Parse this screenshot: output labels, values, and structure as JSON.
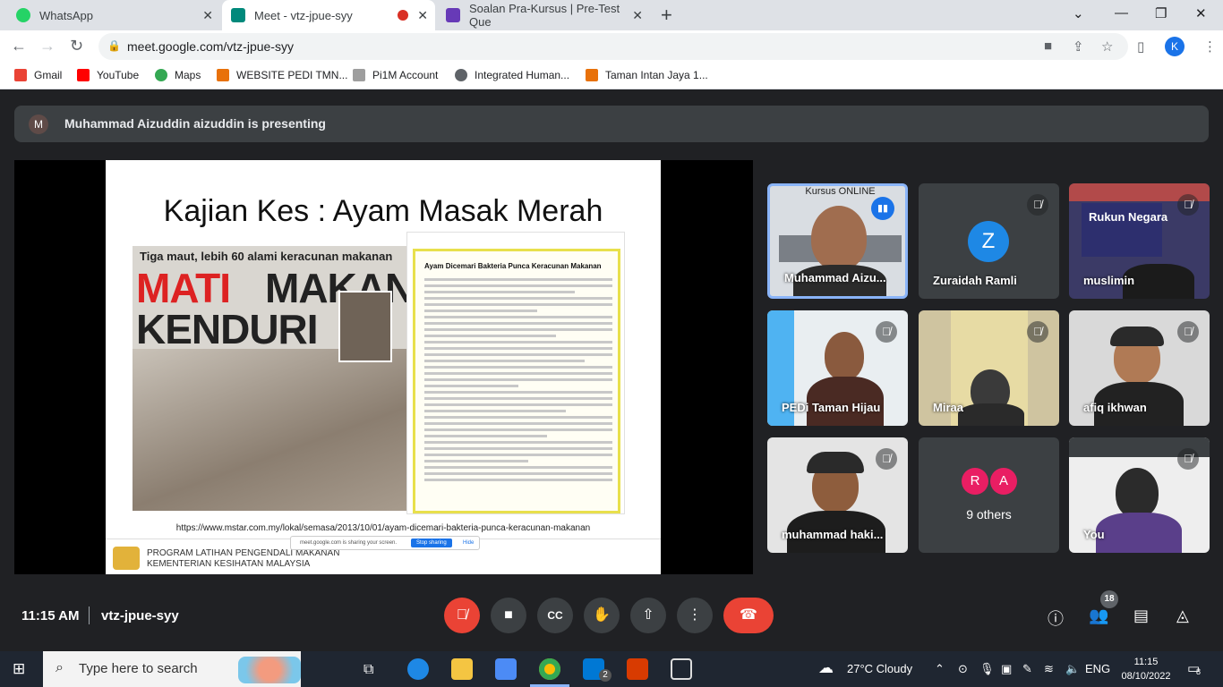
{
  "browser": {
    "tabs": [
      {
        "label": "WhatsApp",
        "favicon_color": "#25d366"
      },
      {
        "label": "Meet - vtz-jpue-syy",
        "favicon_color": "#00897b",
        "recording": true
      },
      {
        "label": "Soalan Pra-Kursus | Pre-Test Que",
        "favicon_color": "#673ab7"
      }
    ],
    "new_tab": "+",
    "url": "meet.google.com/vtz-jpue-syy",
    "profile_initial": "K",
    "bookmarks": [
      {
        "label": "Gmail",
        "color": "#ea4335"
      },
      {
        "label": "YouTube",
        "color": "#ff0000"
      },
      {
        "label": "Maps",
        "color": "#34a853"
      },
      {
        "label": "WEBSITE PEDI TMN...",
        "color": "#e8710a"
      },
      {
        "label": "Pi1M Account",
        "color": "#9e9e9e"
      },
      {
        "label": "Integrated Human...",
        "color": "#5f6368"
      },
      {
        "label": "Taman Intan Jaya 1...",
        "color": "#e8710a"
      }
    ]
  },
  "meet": {
    "presenter_initial": "M",
    "presenting_text": "Muhammad Aizuddin aizuddin is presenting",
    "slide": {
      "title": "Kajian Kes : Ayam Masak Merah",
      "news1_headline": "Tiga maut, lebih 60 alami keracunan makanan",
      "news1_big1": "MATI",
      "news1_big2": "MAKAN",
      "news1_big3": "KENDURI",
      "news2_title": "Ayam Dicemari Bakteria Punca Keracunan Makanan",
      "url": "https://www.mstar.com.my/lokal/semasa/2013/10/01/ayam-dicemari-bakteria-punca-keracunan-makanan",
      "footer_line1": "PROGRAM LATIHAN PENGENDALI MAKANAN",
      "footer_line2": "KEMENTERIAN KESIHATAN MALAYSIA",
      "share_text": "meet.google.com is sharing your screen.",
      "stop_sharing": "Stop sharing",
      "hide": "Hide"
    },
    "tiles": [
      {
        "name": "Muhammad Aizu...",
        "overlay": "Kursus ONLINE",
        "speaking": true
      },
      {
        "name": "Zuraidah Ramli",
        "initial": "Z",
        "avatar_color": "#1e88e5"
      },
      {
        "name": "muslimin"
      },
      {
        "name": "PEDi Taman Hijau"
      },
      {
        "name": "Miraa"
      },
      {
        "name": "afiq ikhwan"
      },
      {
        "name": "muhammad haki..."
      },
      {
        "name": "9 others",
        "initials": [
          "R",
          "A"
        ]
      },
      {
        "name": "You"
      }
    ],
    "muslimin_banner": "Rukun Negara",
    "time": "11:15 AM",
    "meeting_code": "vtz-jpue-syy",
    "participant_count": "18"
  },
  "taskbar": {
    "search_placeholder": "Type here to search",
    "weather": "27°C  Cloudy",
    "lang": "ENG",
    "time": "11:15",
    "date": "08/10/2022",
    "mail_badge": "2",
    "notif_count": "8"
  }
}
